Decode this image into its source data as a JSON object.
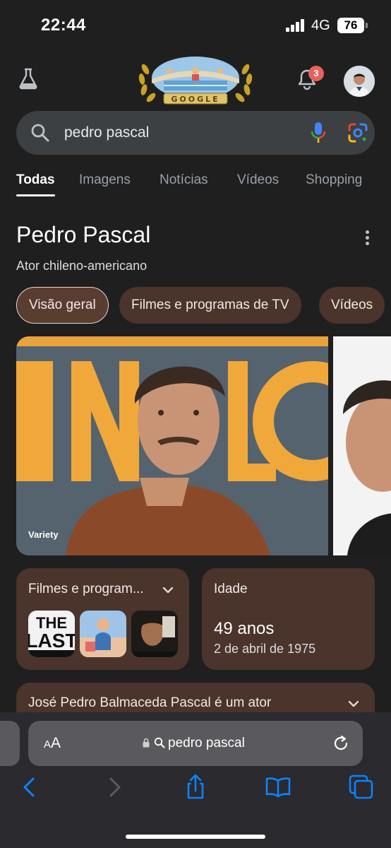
{
  "status_bar": {
    "time": "22:44",
    "network": "4G",
    "battery": "76"
  },
  "header": {
    "notification_count": "3"
  },
  "search": {
    "query": "pedro pascal"
  },
  "tabs": [
    {
      "label": "Todas",
      "active": true
    },
    {
      "label": "Imagens"
    },
    {
      "label": "Notícias"
    },
    {
      "label": "Vídeos"
    },
    {
      "label": "Shopping"
    }
  ],
  "knowledge_panel": {
    "title": "Pedro Pascal",
    "subtitle": "Ator chileno-americano",
    "chips": [
      "Visão geral",
      "Filmes e programas de TV",
      "Vídeos"
    ],
    "image_credit": "Variety",
    "films_card": {
      "title": "Filmes e program..."
    },
    "age_card": {
      "title": "Idade",
      "value": "49 anos",
      "birthdate": "2 de abril de 1975"
    },
    "description": "José Pedro Balmaceda Pascal é um ator"
  },
  "safari": {
    "text_size_label_small": "A",
    "text_size_label_large": "A",
    "address": "pedro pascal"
  }
}
